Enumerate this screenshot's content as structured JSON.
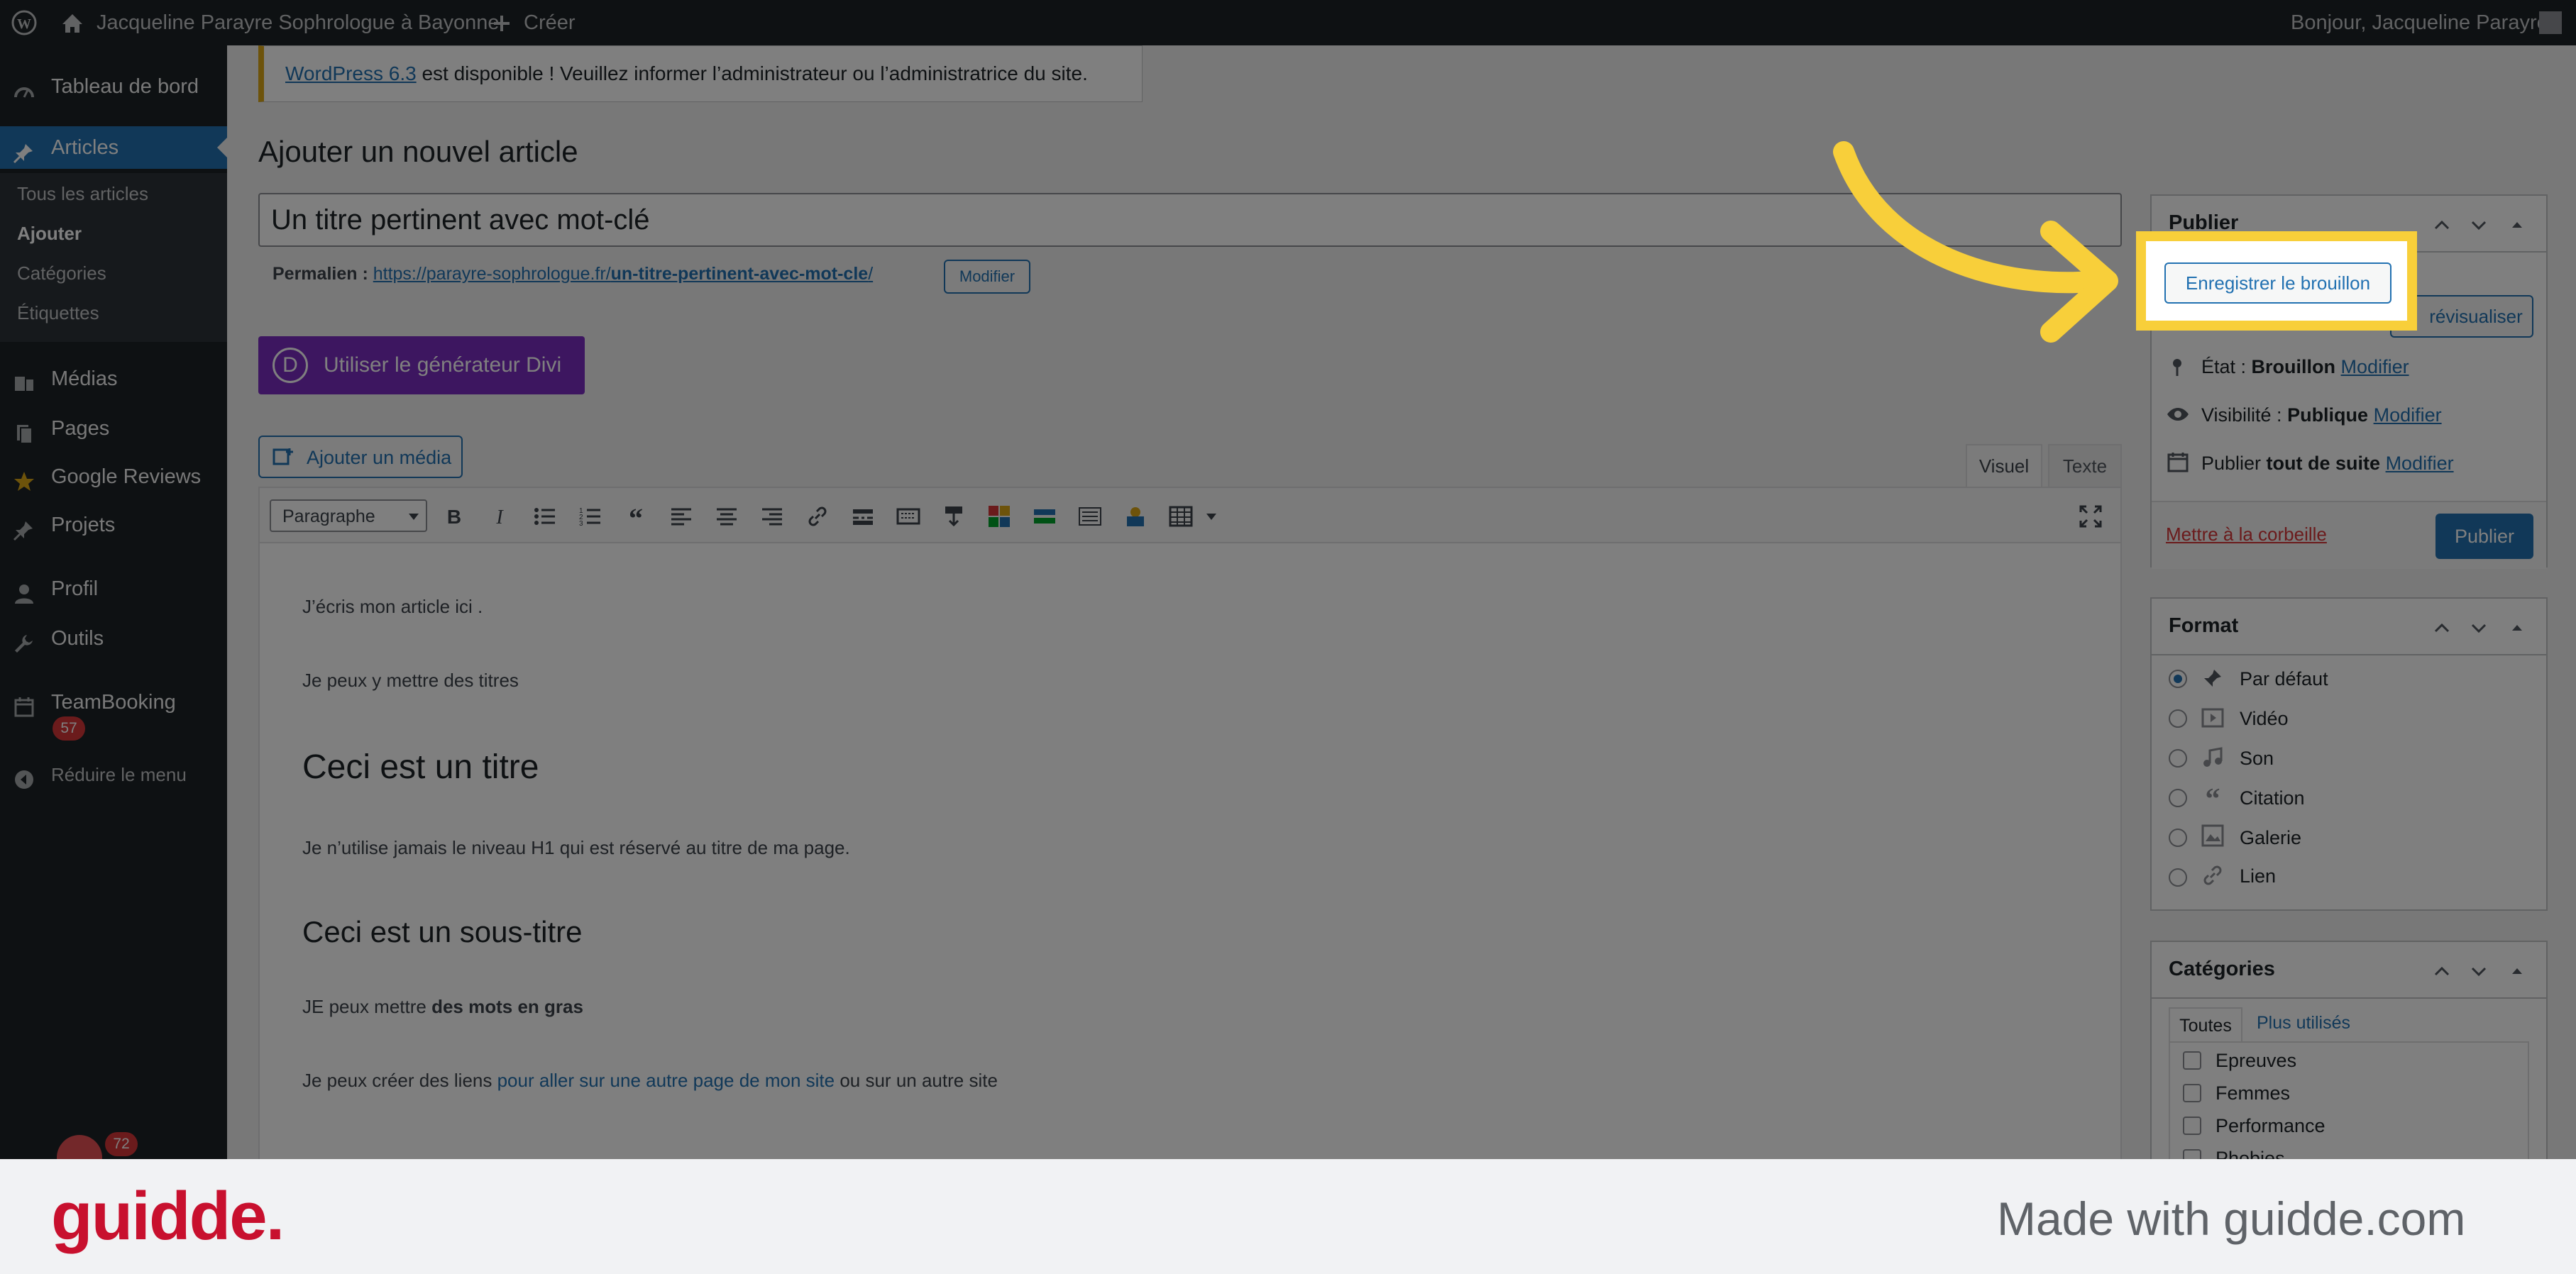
{
  "adminbar": {
    "site_name": "Jacqueline Parayre Sophrologue à Bayonne",
    "create_label": "Créer",
    "greeting": "Bonjour, Jacqueline Parayre"
  },
  "sidebar": {
    "items": [
      {
        "label": "Tableau de bord",
        "icon": "dashboard-icon"
      },
      {
        "label": "Articles",
        "icon": "pin-icon"
      },
      {
        "label": "Médias",
        "icon": "media-icon"
      },
      {
        "label": "Pages",
        "icon": "pages-icon"
      },
      {
        "label": "Google Reviews",
        "icon": "star-icon"
      },
      {
        "label": "Projets",
        "icon": "pin-icon"
      },
      {
        "label": "Profil",
        "icon": "user-icon"
      },
      {
        "label": "Outils",
        "icon": "wrench-icon"
      },
      {
        "label": "TeamBooking",
        "icon": "calendar-icon"
      },
      {
        "label": "Réduire le menu",
        "icon": "collapse-icon"
      }
    ],
    "submenu": [
      "Tous les articles",
      "Ajouter",
      "Catégories",
      "Étiquettes"
    ],
    "teambooking_badge": "57",
    "bottom_badge": "72"
  },
  "notice": {
    "link": "WordPress 6.3",
    "text": " est disponible ! Veuillez informer l’administrateur ou l’administratrice du site."
  },
  "page_title": "Ajouter un nouvel article",
  "post_title": "Un titre pertinent avec mot-clé",
  "permalink": {
    "label": "Permalien :",
    "url_base": "https://parayre-sophrologue.fr/",
    "slug": "un-titre-pertinent-avec-mot-cle",
    "url_end": "/",
    "edit": "Modifier"
  },
  "divi_button": "Utiliser le générateur Divi",
  "divi_letter": "D",
  "add_media": "Ajouter un média",
  "editor_tabs": {
    "visual": "Visuel",
    "text": "Texte"
  },
  "format_select": "Paragraphe",
  "content": {
    "p1": "J’écris mon article ici .",
    "p2": "Je peux y mettre des titres",
    "h1": "Ceci est un titre",
    "p3": "Je n’utilise jamais le niveau H1 qui est réservé au titre de ma page.",
    "h2": "Ceci est un sous-titre",
    "p4_a": "JE peux mettre ",
    "p4_b": "des mots en gras",
    "p5_a": "Je peux créer des liens ",
    "p5_link": "pour aller sur une autre page de mon site",
    "p5_b": " ou sur un autre site"
  },
  "publish_box": {
    "title": "Publier",
    "save_draft": "Enregistrer le brouillon",
    "preview": "Prévisualiser",
    "preview_partial": "révisualiser",
    "status_label": "État : ",
    "status_value": "Brouillon",
    "visibility_label": "Visibilité : ",
    "visibility_value": "Publique",
    "publish_label": "Publier ",
    "publish_value": "tout de suite",
    "edit": "Modifier",
    "trash": "Mettre à la corbeille",
    "publish_button": "Publier"
  },
  "format_box": {
    "title": "Format",
    "options": [
      {
        "label": "Par défaut",
        "icon": "pin-icon",
        "selected": true
      },
      {
        "label": "Vidéo",
        "icon": "video-icon",
        "selected": false
      },
      {
        "label": "Son",
        "icon": "music-icon",
        "selected": false
      },
      {
        "label": "Citation",
        "icon": "quote-icon",
        "selected": false
      },
      {
        "label": "Galerie",
        "icon": "gallery-icon",
        "selected": false
      },
      {
        "label": "Lien",
        "icon": "link-icon",
        "selected": false
      }
    ]
  },
  "categories_box": {
    "title": "Catégories",
    "tab_all": "Toutes",
    "tab_popular": "Plus utilisés",
    "items": [
      "Epreuves",
      "Femmes",
      "Performance",
      "Phobies"
    ]
  },
  "footer": {
    "logo": "guidde.",
    "tagline": "Made with guidde.com"
  },
  "colors": {
    "admin_dark": "#1d2327",
    "wp_blue": "#2271b1",
    "divi_purple": "#7b2dc1",
    "highlight_yellow": "#f8cf3a",
    "guidde_red": "#c8102e",
    "trash_red": "#d63638"
  }
}
